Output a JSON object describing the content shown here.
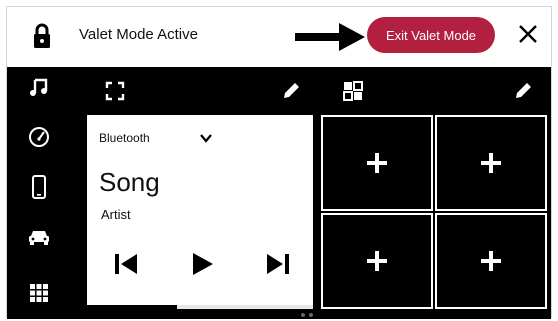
{
  "header": {
    "title": "Valet Mode Active",
    "exit_button": "Exit Valet Mode"
  },
  "sidebar": {
    "items": [
      {
        "icon": "music-icon"
      },
      {
        "icon": "gauge-icon"
      },
      {
        "icon": "phone-icon"
      },
      {
        "icon": "car-icon"
      },
      {
        "icon": "grid-apps-icon"
      }
    ]
  },
  "media": {
    "source": "Bluetooth",
    "song": "Song",
    "artist": "Artist",
    "progress": 0.4
  },
  "tiles": {
    "count": 4
  },
  "pages": {
    "count": 3,
    "current": 1
  }
}
